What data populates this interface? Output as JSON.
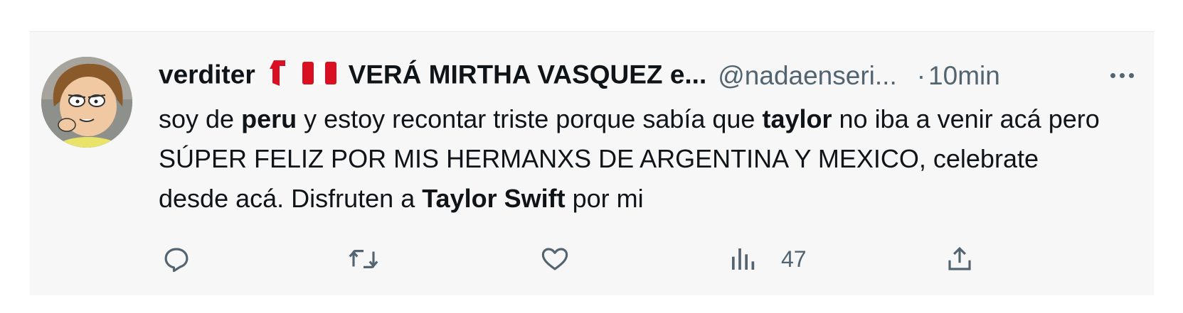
{
  "tweet": {
    "display_name_prefix": "verditer",
    "display_name_suffix": "VERÁ MIRTHA VASQUEZ e...",
    "handle": "@nadaenseri...",
    "separator": "·",
    "time": "10min",
    "body": {
      "seg1": "soy de ",
      "bold1": "peru",
      "seg2": " y estoy recontar triste porque sabía que ",
      "bold2": "taylor",
      "seg3": " no iba a venir acá pero SÚPER FELIZ POR MIS HERMANXS DE ARGENTINA Y MEXICO, celebrate desde acá. Disfruten a ",
      "bold3": "Taylor Swift",
      "seg4": " por mi"
    },
    "actions": {
      "reply_icon": "reply-icon",
      "retweet_icon": "retweet-icon",
      "like_icon": "like-icon",
      "views_icon": "views-icon",
      "views_count": "47",
      "share_icon": "share-icon"
    }
  },
  "colors": {
    "card_bg": "#f7f7f8",
    "text_primary": "#0f1419",
    "text_secondary": "#536471",
    "flag_red": "#d91023"
  }
}
